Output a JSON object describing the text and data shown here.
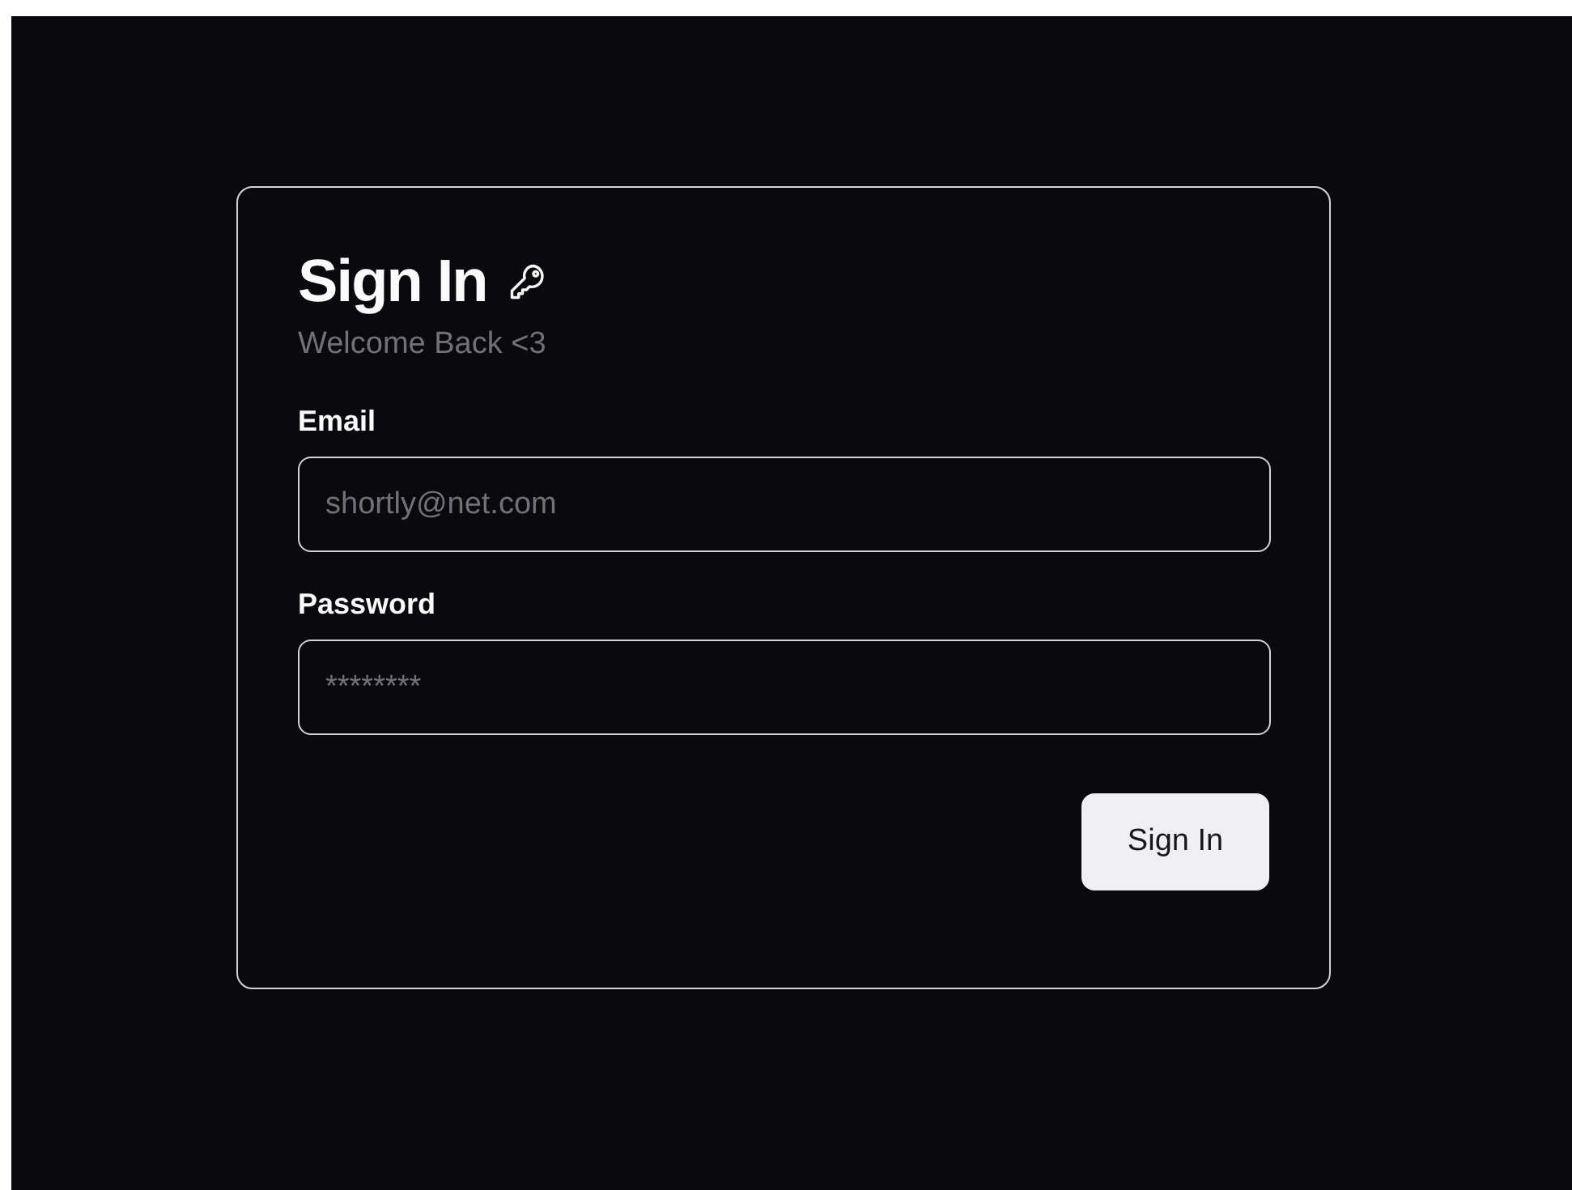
{
  "title": "Sign In",
  "subtitle": "Welcome Back <3",
  "fields": [
    {
      "label": "Email",
      "placeholder": "shortly@net.com"
    },
    {
      "label": "Password",
      "placeholder": "********"
    }
  ],
  "submit": "Sign In"
}
